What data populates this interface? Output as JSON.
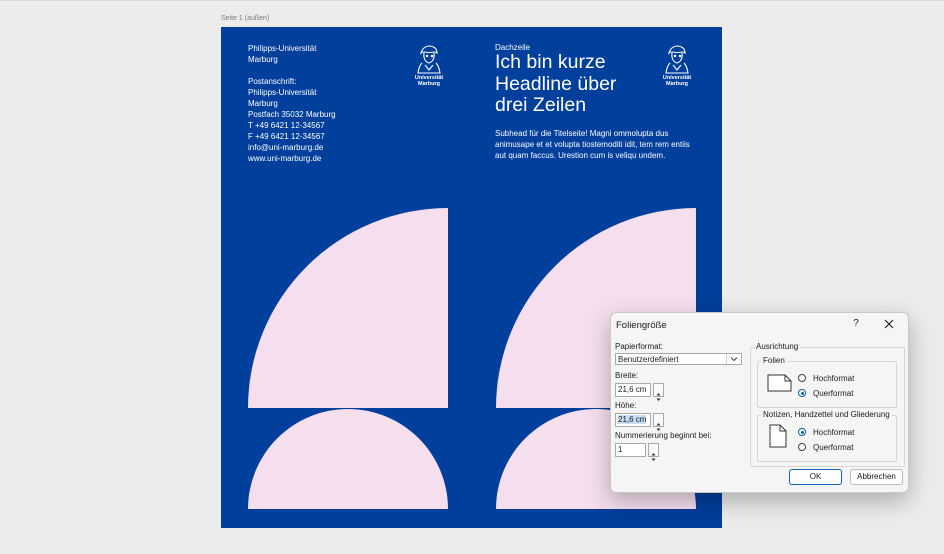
{
  "page_label": "Seite 1 (außen)",
  "slide": {
    "address": {
      "line1": "Philipps-Universität",
      "line2": "Marburg",
      "line3": "Postanschrift:",
      "line4": "Philipps-Universität",
      "line5": "Marburg",
      "line6": "Postfach 35032 Marburg",
      "line7": "T +49 6421 12-34567",
      "line8": "F +49 6421 12-34567",
      "line9": "info@uni-marburg.de",
      "line10": "www.uni-marburg.de"
    },
    "logo": {
      "line1": "Universität",
      "line2": "Marburg"
    },
    "dachzeile": "Dachzeile",
    "headline": {
      "line1": "Ich bin kurze",
      "line2": "Headline über",
      "line3": "drei Zeilen"
    },
    "subhead": {
      "line1": "Subhead für die Titelseite! Magni ommolupta dus",
      "line2": "animusape et et volupta tiostemoditi idit, tem rem entiis",
      "line3": "aut quam faccus. Urestion cum is veliqu undem."
    }
  },
  "dialog": {
    "title": "Foliengröße",
    "help_label": "?",
    "papierformat_label": "Papierformat:",
    "papierformat_value": "Benutzerdefiniert",
    "breite_label": "Breite:",
    "breite_value": "21,6 cm",
    "hoehe_label": "Höhe:",
    "hoehe_value": "21,6 cm",
    "nummerierung_label": "Nummerierung beginnt bei:",
    "nummerierung_value": "1",
    "ausrichtung_label": "Ausrichtung",
    "folien_label": "Folien",
    "folien_hochformat": "Hochformat",
    "folien_querformat": "Querformat",
    "notizen_label": "Notizen, Handzettel und Gliederung",
    "notizen_hochformat": "Hochformat",
    "notizen_querformat": "Querformat",
    "ok_label": "OK",
    "cancel_label": "Abbrechen"
  },
  "colors": {
    "slide_blue": "#003f9c",
    "shape_pink": "#f5dfee",
    "accent": "#0b5cad"
  }
}
